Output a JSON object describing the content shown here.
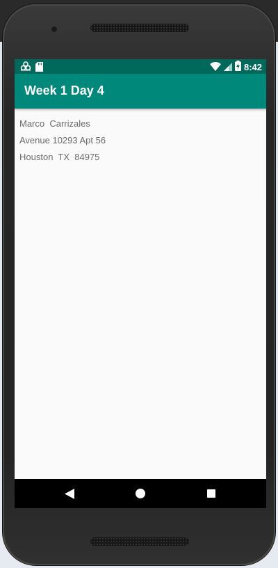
{
  "status_bar": {
    "time": "8:42",
    "icons": [
      "debug-icon",
      "sd-card-icon",
      "wifi-icon",
      "signal-icon",
      "battery-charging-icon"
    ]
  },
  "app_bar": {
    "title": "Week 1 Day 4"
  },
  "content": {
    "name_line": "Marco  Carrizales",
    "street_line": "Avenue 10293 Apt 56",
    "city_line": "Houston  TX  84975"
  },
  "nav_bar": {
    "buttons": [
      "back-icon",
      "home-icon",
      "recents-icon"
    ]
  },
  "colors": {
    "status_bar": "#00695c",
    "app_bar": "#00897b",
    "screen_background": "#fafafa",
    "text": "#6b6b6b"
  }
}
